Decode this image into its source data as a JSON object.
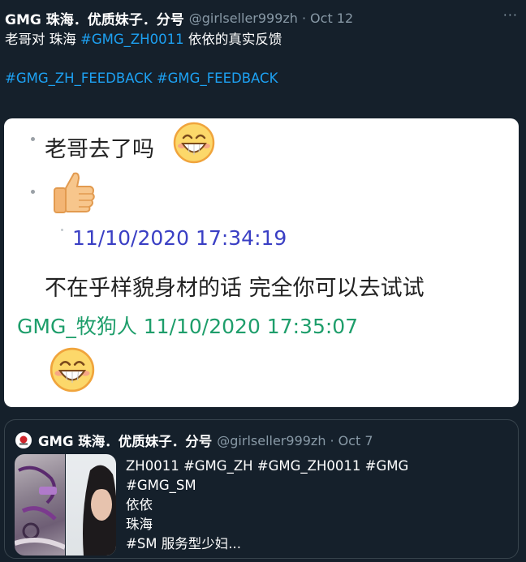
{
  "tweet": {
    "display_name": "GMG 珠海．优质妹子．分号",
    "handle": "@girlseller999zh",
    "separator": "·",
    "time": "Oct 12",
    "more": "···",
    "text_prefix": "老哥对 珠海 ",
    "hashtag_main": "#GMG_ZH0011",
    "text_suffix": " 依依的真实反馈",
    "hashtag_1": "#GMG_ZH_FEEDBACK",
    "hashtag_2": "#GMG_FEEDBACK"
  },
  "media": {
    "message_1": "老哥去了吗",
    "timestamp_1": "11/10/2020 17:34:19",
    "message_2": "不在乎样貌身材的话 完全你可以去试试",
    "sender_line": "GMG_牧狗人 11/10/2020 17:35:07",
    "icons": [
      "grinning-emoji-icon",
      "thumbs-up-icon"
    ]
  },
  "quoted": {
    "display_name": "GMG 珠海．优质妹子．分号",
    "handle": "@girlseller999zh",
    "separator": "·",
    "time": "Oct 7",
    "lines": [
      "ZH0011 #GMG_ZH #GMG_ZH0011 #GMG",
      "#GMG_SM",
      "依依",
      "珠海",
      "#SM 服务型少妇..."
    ]
  },
  "colors": {
    "background": "#15202b",
    "link": "#1da1f2",
    "muted": "#8899a6",
    "chat_timestamp_blue": "#3a3fc4",
    "chat_sender_green": "#1e9e6b"
  }
}
